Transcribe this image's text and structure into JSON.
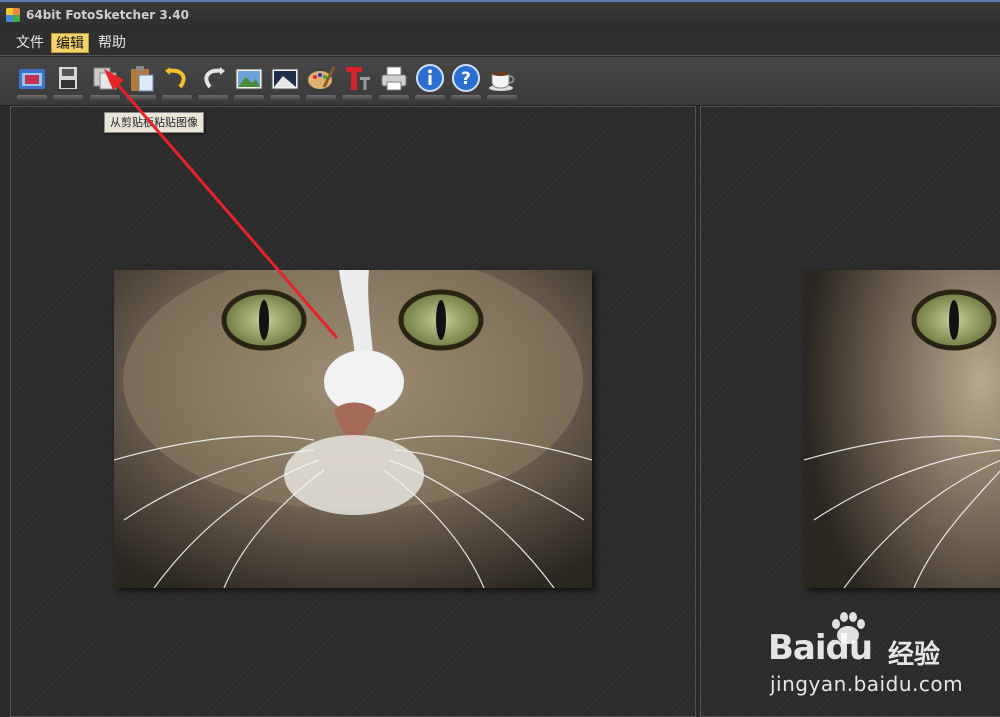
{
  "window": {
    "title": "64bit FotoSketcher 3.40"
  },
  "menu": {
    "items": [
      "文件",
      "编辑",
      "帮助"
    ],
    "active_index": 1
  },
  "toolbar": {
    "buttons": [
      "open-folder-icon",
      "save-disk-icon",
      "copy-image-icon",
      "paste-clipboard-icon",
      "undo-arrow-icon",
      "redo-arrow-icon",
      "landscape-image-icon",
      "landscape-image-2-icon",
      "palette-brush-icon",
      "text-tool-icon",
      "printer-icon",
      "info-icon",
      "help-icon",
      "coffee-cup-icon"
    ],
    "tooltip": "从剪贴板粘贴图像"
  },
  "watermark": {
    "brand": "Baidu",
    "sub": "经验",
    "url": "jingyan.baidu.com"
  },
  "colors": {
    "accent": "#f3d36a",
    "arrow": "#e8232a",
    "background": "#2a2a2a"
  }
}
